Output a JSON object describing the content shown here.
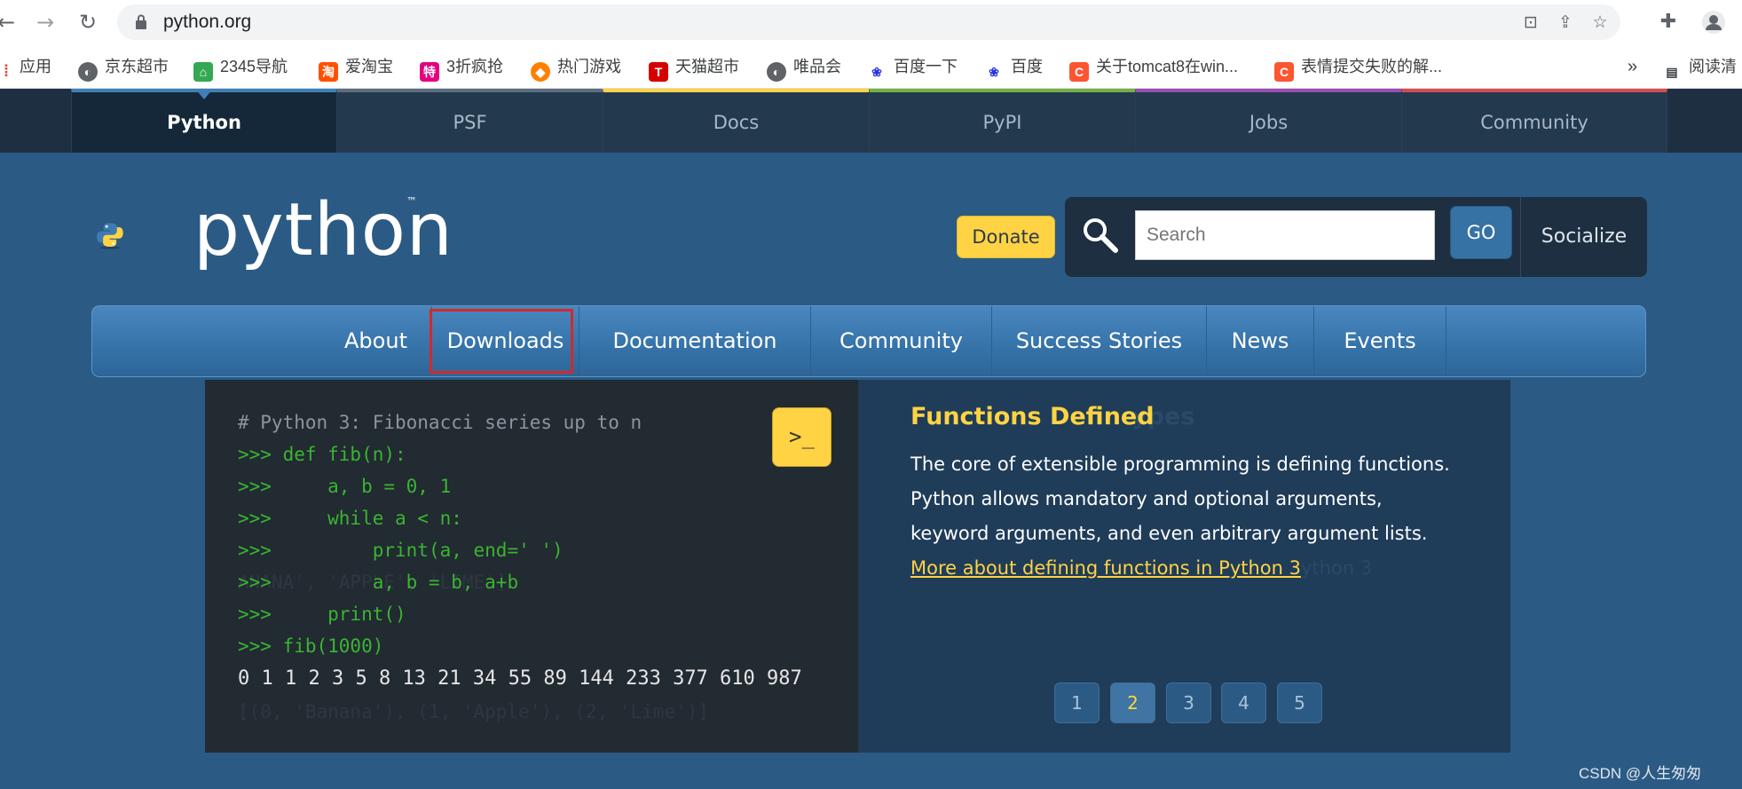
{
  "browser": {
    "url": "python.org",
    "bookmarks": [
      {
        "label": "应用",
        "icon": "apps-icon",
        "color": "#ea4335"
      },
      {
        "label": "京东超市",
        "icon": "globe-icon",
        "color": "#5f6368"
      },
      {
        "label": "2345导航",
        "icon": "house-icon",
        "color": "#34a853"
      },
      {
        "label": "爱淘宝",
        "icon": "taobao-icon",
        "color": "#ff5000"
      },
      {
        "label": "3折疯抢",
        "icon": "te-icon",
        "color": "#e4007f"
      },
      {
        "label": "热门游戏",
        "icon": "game-icon",
        "color": "#ff7f00"
      },
      {
        "label": "天猫超市",
        "icon": "tmall-icon",
        "color": "#d50000"
      },
      {
        "label": "唯品会",
        "icon": "globe-icon",
        "color": "#5f6368"
      },
      {
        "label": "百度一下",
        "icon": "baidu-icon",
        "color": "#2932e1"
      },
      {
        "label": "百度",
        "icon": "baidu-icon",
        "color": "#2932e1"
      },
      {
        "label": "关于tomcat8在win...",
        "icon": "csdn-icon",
        "color": "#fc5531"
      },
      {
        "label": "表情提交失败的解...",
        "icon": "csdn-icon",
        "color": "#fc5531"
      }
    ],
    "more_label": "»",
    "reading_list": "阅读清"
  },
  "topnav": {
    "items": [
      "Python",
      "PSF",
      "Docs",
      "PyPI",
      "Jobs",
      "Community"
    ],
    "colors": [
      "#3f7fb5",
      "#5c6d80",
      "#ffd343",
      "#76b043",
      "#9c4db3",
      "#d64d4d"
    ]
  },
  "header": {
    "logo_text": "python",
    "tm": "™",
    "donate": "Donate",
    "search_placeholder": "Search",
    "go": "GO",
    "socialize": "Socialize"
  },
  "mainmenu": {
    "items": [
      "About",
      "Downloads",
      "Documentation",
      "Community",
      "Success Stories",
      "News",
      "Events"
    ]
  },
  "code": {
    "comment": "# Python 3: Fibonacci series up to n",
    "lines": [
      {
        "prompt": ">>> ",
        "code": "def fib(n):"
      },
      {
        "prompt": ">>> ",
        "code": "    a, b = 0, 1"
      },
      {
        "prompt": ">>> ",
        "code": "    while a < n:"
      },
      {
        "prompt": ">>> ",
        "code": "        print(a, end=' ')"
      },
      {
        "prompt": ">>> ",
        "code": "        a, b = b, a+b"
      },
      {
        "prompt": ">>> ",
        "code": "    print()"
      },
      {
        "prompt": ">>> ",
        "code": "fib(1000)"
      }
    ],
    "output": "0 1 1 2 3 5 8 13 21 34 55 89 144 233 377 610 987",
    "ghost_output": "[(0, 'Banana'), (1, 'Apple'), (2, 'Lime')]",
    "ghost_fragment": "ANANA', 'APPLE', 'LIME']",
    "shell_label": ">_"
  },
  "feature": {
    "title": "Functions Defined",
    "ghost_title": "ypes",
    "text": "The core of extensible programming is defining functions. Python allows mandatory and optional arguments, keyword arguments, and even arbitrary argument lists. ",
    "link": "More about defining functions in Python 3",
    "ghost_link": "ython 3",
    "pages": [
      "1",
      "2",
      "3",
      "4",
      "5"
    ],
    "active_page": "2"
  },
  "watermark": "CSDN @人生匆匆"
}
